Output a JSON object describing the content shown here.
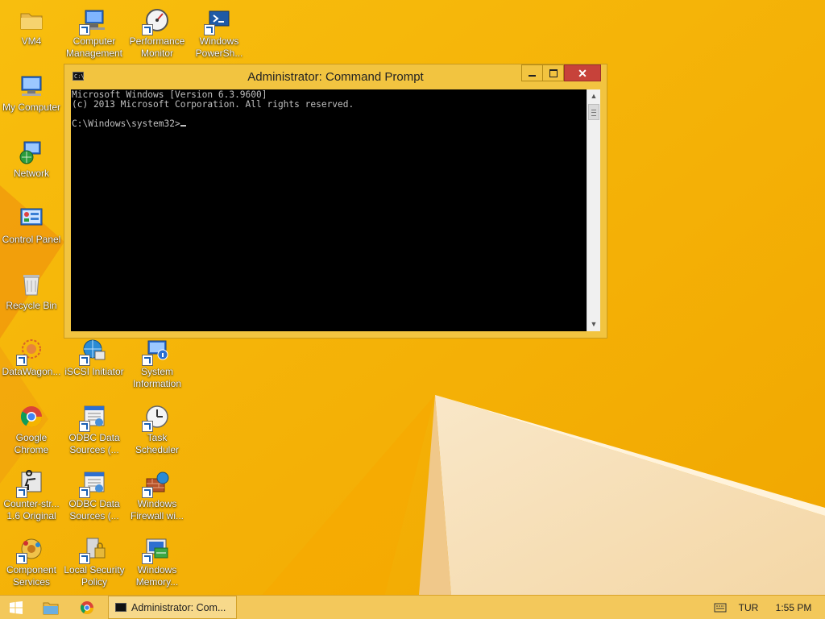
{
  "desktop": {
    "icons": [
      {
        "label": "VM4",
        "icon": "folder-icon"
      },
      {
        "label": "Computer\nManagement",
        "icon": "computer-management-icon"
      },
      {
        "label": "Performance\nMonitor",
        "icon": "performance-monitor-icon"
      },
      {
        "label": "Windows\nPowerSh...",
        "icon": "powershell-icon"
      },
      {
        "label": "My Computer",
        "icon": "my-computer-icon"
      },
      {
        "label": "Network",
        "icon": "network-icon"
      },
      {
        "label": "Control Panel",
        "icon": "control-panel-icon"
      },
      {
        "label": "Recycle Bin",
        "icon": "recycle-bin-icon"
      },
      {
        "label": "DataWagon...",
        "icon": "datawagon-icon"
      },
      {
        "label": "iSCSI Initiator",
        "icon": "iscsi-initiator-icon"
      },
      {
        "label": "System\nInformation",
        "icon": "system-information-icon"
      },
      {
        "label": "Google\nChrome",
        "icon": "chrome-icon"
      },
      {
        "label": "ODBC Data\nSources (...",
        "icon": "odbc-icon"
      },
      {
        "label": "Task\nScheduler",
        "icon": "task-scheduler-icon"
      },
      {
        "label": "Counter-str...\n1.6 Original",
        "icon": "counter-strike-icon"
      },
      {
        "label": "ODBC Data\nSources (...",
        "icon": "odbc-icon"
      },
      {
        "label": "Windows\nFirewall wi...",
        "icon": "firewall-icon"
      },
      {
        "label": "Component\nServices",
        "icon": "component-services-icon"
      },
      {
        "label": "Local Security\nPolicy",
        "icon": "local-security-policy-icon"
      },
      {
        "label": "Windows\nMemory...",
        "icon": "memory-diagnostic-icon"
      }
    ]
  },
  "window": {
    "title": "Administrator: Command Prompt",
    "app_icon_text": "C:\\",
    "console_lines": [
      "Microsoft Windows [Version 6.3.9600]",
      "(c) 2013 Microsoft Corporation. All rights reserved.",
      "",
      "C:\\Windows\\system32>"
    ],
    "close_glyph": "✕"
  },
  "taskbar": {
    "cmd_label": "Administrator: Com...",
    "language": "TUR",
    "time": "1:55 PM"
  },
  "colors": {
    "wallpaper": "#f6b300",
    "window_frame": "#f2c440",
    "close_button": "#c7423a",
    "console_bg": "#000000",
    "console_text": "#c0c0c0"
  }
}
